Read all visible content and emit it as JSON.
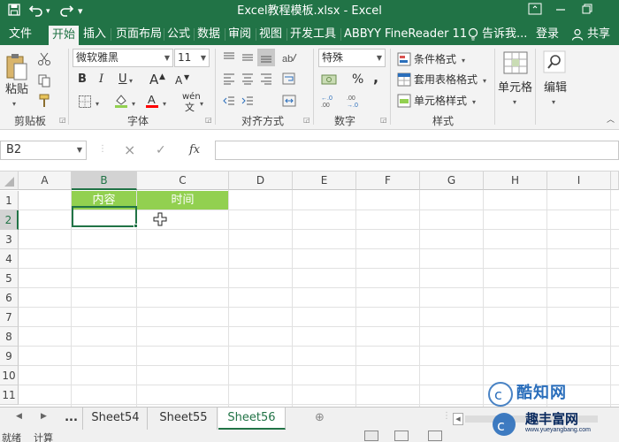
{
  "titlebar": {
    "title": "Excel教程模板.xlsx - Excel",
    "save_icon": "save-icon",
    "undo_icon": "undo-icon",
    "redo_icon": "redo-icon"
  },
  "tabs": [
    {
      "label": "文件"
    },
    {
      "label": "开始"
    },
    {
      "label": "插入"
    },
    {
      "label": "页面布局"
    },
    {
      "label": "公式"
    },
    {
      "label": "数据"
    },
    {
      "label": "审阅"
    },
    {
      "label": "视图"
    },
    {
      "label": "开发工具"
    },
    {
      "label": "ABBYY FineReader 11"
    }
  ],
  "tellme": {
    "label": "告诉我..."
  },
  "account": {
    "signin": "登录",
    "share": "共享"
  },
  "ribbon": {
    "clipboard": {
      "group": "剪贴板",
      "paste": "粘贴"
    },
    "font": {
      "group": "字体",
      "name": "微软雅黑",
      "size": "11",
      "bold": "B",
      "italic": "I",
      "underline": "U",
      "grow": "A",
      "shrink": "A",
      "phonetic": "wén"
    },
    "alignment": {
      "group": "对齐方式"
    },
    "number": {
      "group": "数字",
      "format": "特殊",
      "percent": "%",
      "comma": ","
    },
    "styles": {
      "group": "样式",
      "conditional": "条件格式",
      "table": "套用表格格式",
      "cell": "单元格样式"
    },
    "cells": {
      "label": "单元格"
    },
    "editing": {
      "label": "编辑"
    }
  },
  "formula": {
    "namebox": "B2",
    "cancel": "×",
    "enter": "✓",
    "fx": "fx",
    "value": ""
  },
  "grid": {
    "columns": [
      "A",
      "B",
      "C",
      "D",
      "E",
      "F",
      "G",
      "H",
      "I"
    ],
    "rows": [
      "1",
      "2",
      "3",
      "4",
      "5",
      "6",
      "7",
      "8",
      "9",
      "10",
      "11"
    ],
    "selected_col": "B",
    "selected_row": "2",
    "cells": {
      "B1": "内容",
      "C1": "时间"
    },
    "header_fill": "#92d050"
  },
  "sheets": {
    "more": "...",
    "tabs": [
      "Sheet54",
      "Sheet55",
      "Sheet56"
    ],
    "active": "Sheet56"
  },
  "status": {
    "ready": "就绪",
    "calc": "计算"
  },
  "watermark": {
    "brand": "酷知网",
    "subtitle": "趣丰富网",
    "url": "www.yueyangbang.com"
  },
  "colors": {
    "accent": "#217346",
    "header_fill": "#92d050"
  }
}
